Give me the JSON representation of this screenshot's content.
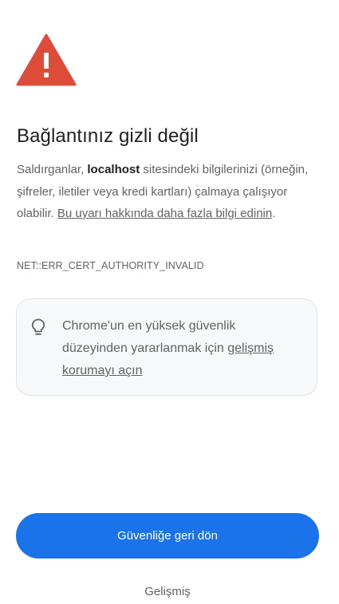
{
  "icons": {
    "warning": "warning-triangle-icon",
    "tip": "lightbulb-icon"
  },
  "colors": {
    "warning_red": "#dd4b39",
    "primary_blue": "#1a73e8",
    "text_secondary": "#5f6368"
  },
  "heading": "Bağlantınız gizli değil",
  "message": {
    "prefix": "Saldırganlar, ",
    "host": "localhost",
    "suffix": " sitesindeki bilgilerinizi (örneğin, şifreler, iletiler veya kredi kartları) çalmaya çalışıyor olabilir. ",
    "learn_more_link": "Bu uyarı hakkında daha fazla bilgi edinin",
    "end": "."
  },
  "error_code": "NET::ERR_CERT_AUTHORITY_INVALID",
  "tip": {
    "text": "Chrome'un en yüksek güvenlik düzeyinden yararlanmak için ",
    "link": "gelişmiş korumayı açın"
  },
  "buttons": {
    "back_to_safety": "Güvenliğe geri dön",
    "advanced": "Gelişmiş"
  }
}
